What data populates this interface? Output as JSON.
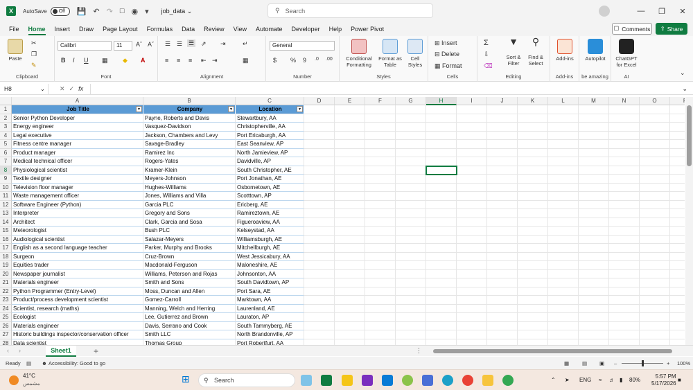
{
  "titlebar": {
    "autosave_label": "AutoSave",
    "autosave_state": "Off",
    "doc_title": "job_data",
    "search_placeholder": "Search"
  },
  "menu": [
    "File",
    "Home",
    "Insert",
    "Draw",
    "Page Layout",
    "Formulas",
    "Data",
    "Review",
    "View",
    "Automate",
    "Developer",
    "Help",
    "Power Pivot"
  ],
  "actions": {
    "comments": "Comments",
    "share": "Share"
  },
  "ribbon": {
    "paste": "Paste",
    "clipboard": "Clipboard",
    "font_name": "Calibri",
    "font_size": "11",
    "font": "Font",
    "alignment": "Alignment",
    "number_format": "General",
    "number": "Number",
    "conditional_formatting": "Conditional Formatting",
    "format_as_table": "Format as Table",
    "cell_styles": "Cell Styles",
    "styles": "Styles",
    "insert": "Insert",
    "delete": "Delete",
    "format": "Format",
    "cells": "Cells",
    "sort_filter": "Sort & Filter",
    "find_select": "Find & Select",
    "editing": "Editing",
    "addins": "Add-ins",
    "addins_group": "Add-ins",
    "autopilot": "Autopilot",
    "be_amazing": "be amazing",
    "chatgpt": "ChatGPT for Excel",
    "ai": "AI",
    "bold": "B",
    "italic": "I",
    "underline": "U",
    "currency": "$",
    "percent": "%",
    "comma": "9"
  },
  "formula_bar": {
    "name_box": "H8",
    "fx": "fx",
    "content": ""
  },
  "columns": [
    "A",
    "B",
    "C",
    "D",
    "E",
    "F",
    "G",
    "H",
    "I",
    "J",
    "K",
    "L",
    "M",
    "N",
    "O",
    "P"
  ],
  "table": {
    "headers": [
      "Job Title",
      "Company",
      "Location"
    ],
    "rows": [
      [
        "Senior Python Developer",
        "Payne, Roberts and Davis",
        "Stewartbury, AA"
      ],
      [
        "Energy engineer",
        "Vasquez-Davidson",
        "Christopherville, AA"
      ],
      [
        "Legal executive",
        "Jackson, Chambers and Levy",
        "Port Ericaburgh, AA"
      ],
      [
        "Fitness centre manager",
        "Savage-Bradley",
        "East Seanview, AP"
      ],
      [
        "Product manager",
        "Ramirez Inc",
        "North Jamieview, AP"
      ],
      [
        "Medical technical officer",
        "Rogers-Yates",
        "Davidville, AP"
      ],
      [
        "Physiological scientist",
        "Kramer-Klein",
        "South Christopher, AE"
      ],
      [
        "Textile designer",
        "Meyers-Johnson",
        "Port Jonathan, AE"
      ],
      [
        "Television floor manager",
        "Hughes-Williams",
        "Osbornetown, AE"
      ],
      [
        "Waste management officer",
        "Jones, Williams and Villa",
        "Scotttown, AP"
      ],
      [
        "Software Engineer (Python)",
        "Garcia PLC",
        "Ericberg, AE"
      ],
      [
        "Interpreter",
        "Gregory and Sons",
        "Ramireztown, AE"
      ],
      [
        "Architect",
        "Clark, Garcia and Sosa",
        "Figueroaview, AA"
      ],
      [
        "Meteorologist",
        "Bush PLC",
        "Kelseystad, AA"
      ],
      [
        "Audiological scientist",
        "Salazar-Meyers",
        "Williamsburgh, AE"
      ],
      [
        "English as a second language teacher",
        "Parker, Murphy and Brooks",
        "Mitchellburgh, AE"
      ],
      [
        "Surgeon",
        "Cruz-Brown",
        "West Jessicabury, AA"
      ],
      [
        "Equities trader",
        "Macdonald-Ferguson",
        "Maloneshire, AE"
      ],
      [
        "Newspaper journalist",
        "Williams, Peterson and Rojas",
        "Johnsonton, AA"
      ],
      [
        "Materials engineer",
        "Smith and Sons",
        "South Davidtown, AP"
      ],
      [
        "Python Programmer (Entry-Level)",
        "Moss, Duncan and Allen",
        "Port Sara, AE"
      ],
      [
        "Product/process development scientist",
        "Gomez-Carroll",
        "Marktown, AA"
      ],
      [
        "Scientist, research (maths)",
        "Manning, Welch and Herring",
        "Laurenland, AE"
      ],
      [
        "Ecologist",
        "Lee, Gutierrez and Brown",
        "Lauraton, AP"
      ],
      [
        "Materials engineer",
        "Davis, Serrano and Cook",
        "South Tammyberg, AE"
      ],
      [
        "Historic buildings inspector/conservation officer",
        "Smith LLC",
        "North Brandonville, AP"
      ],
      [
        "Data scientist",
        "Thomas Group",
        "Port Robertfurt, AA"
      ]
    ]
  },
  "sheet_tab": "Sheet1",
  "status": {
    "ready": "Ready",
    "accessibility": "Accessibility: Good to go",
    "zoom": "100%"
  },
  "taskbar": {
    "temperature": "41°C",
    "weather_desc": "مشمس",
    "search": "Search",
    "lang": "ENG",
    "battery": "80%",
    "time": "5:57 PM",
    "date": "5/17/2026"
  },
  "colors": {
    "accent": "#107c41",
    "table_header": "#5b9bd5"
  }
}
